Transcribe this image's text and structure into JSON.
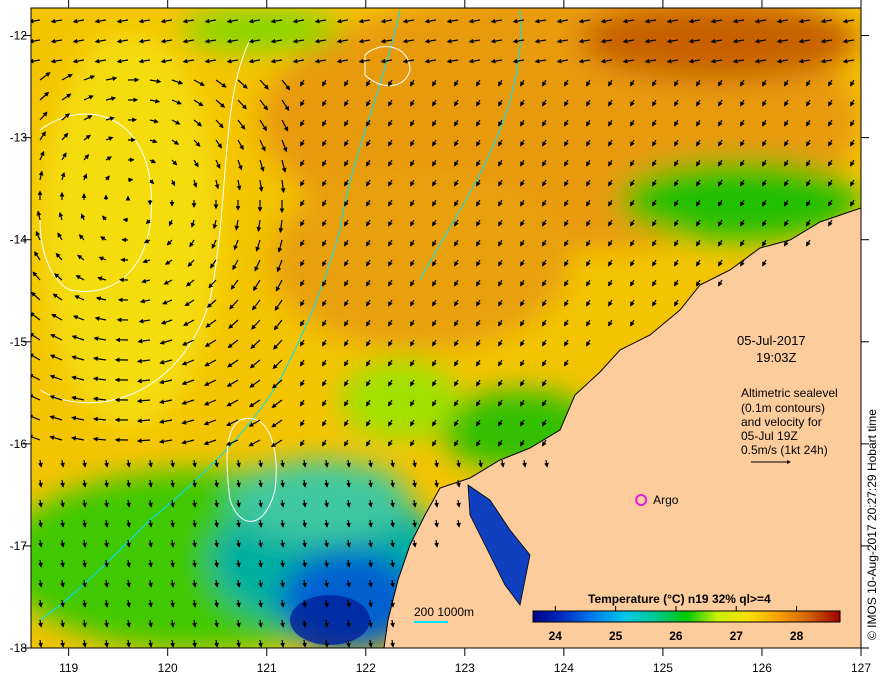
{
  "map": {
    "lon_range": [
      118.62,
      127
    ],
    "lat_range": [
      -18,
      -11.73
    ],
    "x_ticks": [
      "119",
      "120",
      "121",
      "122",
      "123",
      "124",
      "125",
      "126",
      "127"
    ],
    "y_ticks": [
      "-12",
      "-13",
      "-14",
      "-15",
      "-16",
      "-17",
      "-18"
    ],
    "date": "05-Jul-2017",
    "time": "19:03Z",
    "altimetry_lines": [
      "Altimetric sealevel",
      "(0.1m contours)",
      "and velocity for",
      "05-Jul 19Z",
      "0.5m/s (1kt 24h)"
    ],
    "argo_label": "Argo",
    "argo_color": "#e020e0",
    "argo_position": [
      124.78,
      -16.55
    ],
    "isobath_label": "200  1000m",
    "isobath_color": "#00e0ff",
    "credit": "© IMOS 10-Aug-2017 20:27:29 Hobart time",
    "land_color": "#fccc9c"
  },
  "colorbar": {
    "title": "Temperature (°C) n19 32% ql>=4",
    "range": [
      23.63,
      28.72
    ],
    "ticks": [
      "24",
      "25",
      "26",
      "27",
      "28"
    ],
    "colors": [
      "#00008c",
      "#0030c0",
      "#0080f0",
      "#00c8e8",
      "#00c890",
      "#00c800",
      "#c8f000",
      "#f8e000",
      "#f8a000",
      "#d06000",
      "#a00000"
    ]
  }
}
